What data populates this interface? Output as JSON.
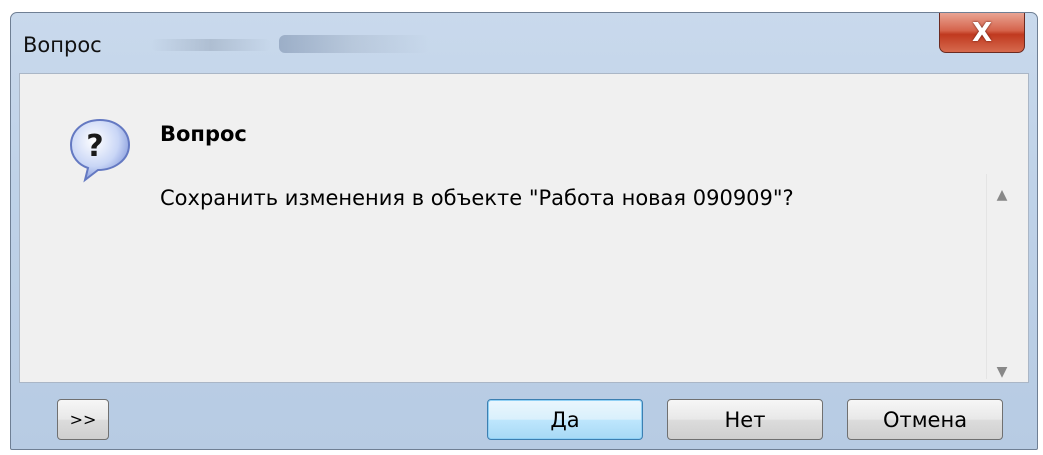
{
  "window": {
    "title": "Вопрос",
    "close_label": "X"
  },
  "dialog": {
    "header": "Вопрос",
    "message": "Сохранить изменения в объекте \"Работа новая 090909\"?",
    "icon": "question-icon"
  },
  "buttons": {
    "more": ">>",
    "yes": "Да",
    "no": "Нет",
    "cancel": "Отмена"
  },
  "colors": {
    "titlebar": "#bfd2e8",
    "close": "#c0391f",
    "default_button_border": "#3c7fb1"
  }
}
